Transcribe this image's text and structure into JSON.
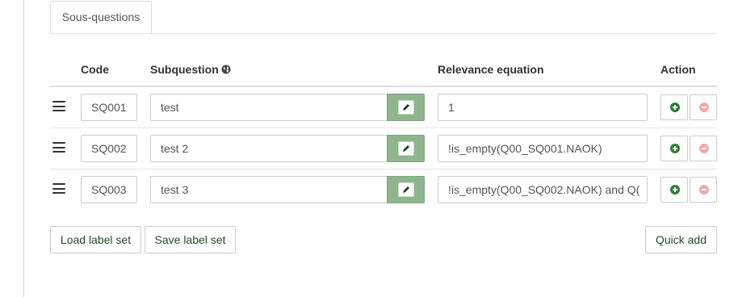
{
  "tabs": [
    {
      "label": "Sous-questions"
    }
  ],
  "table": {
    "headers": {
      "code": "Code",
      "subquestion": "Subquestion",
      "relevance": "Relevance equation",
      "action": "Action"
    },
    "rows": [
      {
        "code": "SQ001",
        "subquestion": "test",
        "relevance": "1"
      },
      {
        "code": "SQ002",
        "subquestion": "test 2",
        "relevance": "!is_empty(Q00_SQ001.NAOK)"
      },
      {
        "code": "SQ003",
        "subquestion": "test 3",
        "relevance": "!is_empty(Q00_SQ002.NAOK) and Q("
      }
    ]
  },
  "buttons": {
    "load_label_set": "Load label set",
    "save_label_set": "Save label set",
    "quick_add": "Quick add"
  },
  "icons": {
    "drag": "drag-handle-icon",
    "globe": "globe-icon",
    "edit": "pencil-icon",
    "add": "plus-circle-icon",
    "remove": "minus-circle-icon"
  },
  "colors": {
    "edit_button_bg": "#8fb58f",
    "add_icon": "#2e7d32",
    "remove_icon": "#f2a9a9",
    "button_text": "#1f4f1f"
  }
}
